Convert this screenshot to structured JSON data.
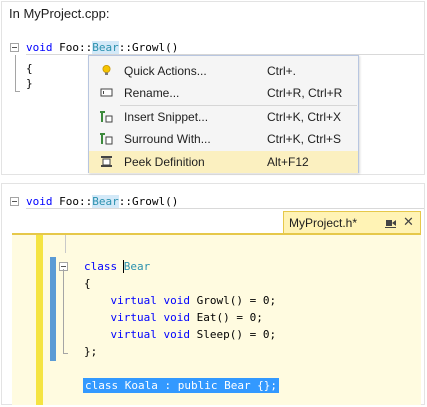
{
  "top": {
    "caption": "In MyProject.cpp:",
    "signature": {
      "kw": "void",
      "prefix": " Foo::",
      "symbol": "Bear",
      "suffix": "::Growl()"
    },
    "brace_open": "{",
    "brace_close": "}"
  },
  "context_menu": {
    "items": [
      {
        "label": "Quick Actions...",
        "shortcut": "Ctrl+.",
        "icon": "lightbulb-icon"
      },
      {
        "label": "Rename...",
        "shortcut": "Ctrl+R, Ctrl+R",
        "icon": "rename-icon"
      },
      {
        "label": "Insert Snippet...",
        "shortcut": "Ctrl+K, Ctrl+X",
        "icon": "insert-snippet-icon"
      },
      {
        "label": "Surround With...",
        "shortcut": "Ctrl+K, Ctrl+S",
        "icon": "surround-with-icon"
      },
      {
        "label": "Peek Definition",
        "shortcut": "Alt+F12",
        "icon": "peek-definition-icon"
      }
    ]
  },
  "bottom": {
    "signature": {
      "kw": "void",
      "prefix": " Foo::",
      "symbol": "Bear",
      "suffix": "::Growl()"
    },
    "peek": {
      "tab_title": "MyProject.h*",
      "close_glyph": "✕",
      "code": {
        "l1_kw": "class",
        "l1_name": "Bear",
        "l2": "{",
        "methods": [
          {
            "kw1": "virtual",
            "kw2": "void",
            "rest": " Growl() = 0;"
          },
          {
            "kw1": "virtual",
            "kw2": "void",
            "rest": " Eat() = 0;"
          },
          {
            "kw1": "virtual",
            "kw2": "void",
            "rest": " Sleep() = 0;"
          }
        ],
        "close": "};",
        "selected_line": "class Koala : public Bear {};"
      }
    }
  },
  "colors": {
    "keyword": "#0000ff",
    "type": "#2b91af",
    "peek_bg": "#fffbe0",
    "peek_accent": "#f5e442",
    "selection": "#3399ff"
  }
}
